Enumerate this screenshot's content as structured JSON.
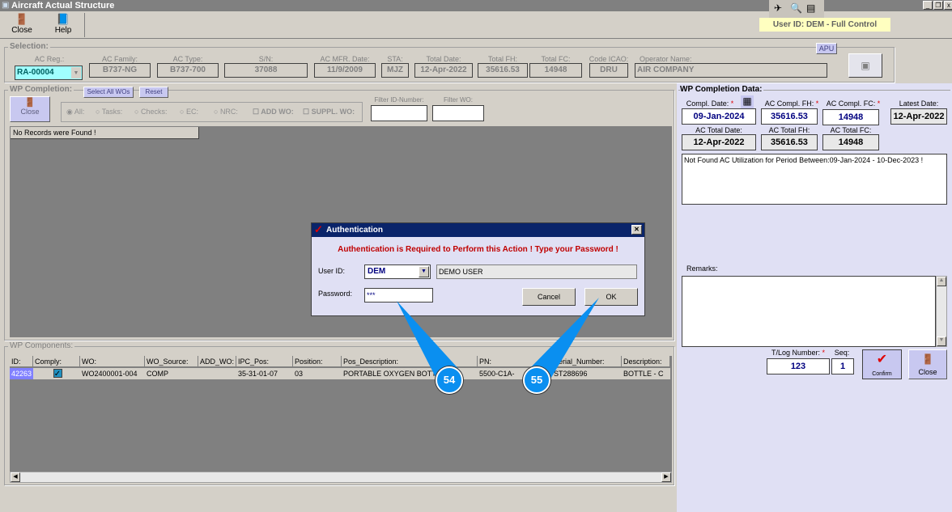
{
  "window": {
    "title": "Aircraft Actual Structure",
    "user_badge": "User ID: DEM - Full Control"
  },
  "toolbar": {
    "close": "Close",
    "help": "Help"
  },
  "selection": {
    "title": "Selection:",
    "apu": "APU",
    "fields": [
      {
        "label": "AC Reg.:",
        "value": "RA-00004"
      },
      {
        "label": "AC Family:",
        "value": "B737-NG"
      },
      {
        "label": "AC Type:",
        "value": "B737-700"
      },
      {
        "label": "S/N:",
        "value": "37088"
      },
      {
        "label": "AC MFR. Date:",
        "value": "11/9/2009"
      },
      {
        "label": "STA:",
        "value": "MJZ"
      },
      {
        "label": "Total Date:",
        "value": "12-Apr-2022"
      },
      {
        "label": "Total FH:",
        "value": "35616.53"
      },
      {
        "label": "Total FC:",
        "value": "14948"
      },
      {
        "label": "Code ICAO:",
        "value": "DRU"
      },
      {
        "label": "Operator Name:",
        "value": "AIR COMPANY"
      }
    ]
  },
  "wp_completion": {
    "title": "WP Completion:",
    "select_all": "Select All WOs",
    "reset": "Reset",
    "close": "Close",
    "radios": [
      "All:",
      "Tasks:",
      "Checks:",
      "EC:",
      "NRC:"
    ],
    "checks": [
      "ADD WO:",
      "SUPPL. WO:"
    ],
    "filter_id_label": "Filter ID-Number:",
    "filter_wo_label": "Filter WO:",
    "no_records": "No Records were Found !"
  },
  "wp_components": {
    "title": "WP Components:",
    "columns": [
      "ID:",
      "Comply:",
      "WO:",
      "WO_Source:",
      "ADD_WO:",
      "IPC_Pos:",
      "Position:",
      "Pos_Description:",
      "PN:",
      "Serial_Number:",
      "Description:"
    ],
    "rows": [
      [
        "42263",
        "",
        "WO2400001-004",
        "COMP",
        "",
        "35-31-01-07",
        "03",
        "PORTABLE OXYGEN BOTTLE",
        "5500-C1A-",
        "ST288696",
        "BOTTLE - C"
      ]
    ]
  },
  "wp_data": {
    "title": "WP Completion Data:",
    "compl_date_label": "Compl. Date:",
    "compl_date": "09-Jan-2024",
    "compl_fh_label": "AC Compl. FH:",
    "compl_fh": "35616.53",
    "compl_fc_label": "AC Compl. FC:",
    "compl_fc": "14948",
    "latest_label": "Latest Date:",
    "latest": "12-Apr-2022",
    "total_date_label": "AC Total Date:",
    "total_date": "12-Apr-2022",
    "total_fh_label": "AC Total FH:",
    "total_fh": "35616.53",
    "total_fc_label": "AC Total FC:",
    "total_fc": "14948",
    "message": "Not Found AC Utilization for Period Between:09-Jan-2024 - 10-Dec-2023 !",
    "remarks_label": "Remarks:",
    "tlog_label": "T/Log Number:",
    "tlog": "123",
    "seq_label": "Seq:",
    "seq": "1",
    "confirm": "Confirm",
    "close": "Close",
    "required": "*"
  },
  "dialog": {
    "title": "Authentication",
    "message": "Authentication is Required to Perform this Action ! Type your Password !",
    "user_label": "User ID:",
    "user": "DEM",
    "user_name": "DEMO USER",
    "password_label": "Password:",
    "password": "***",
    "cancel": "Cancel",
    "ok": "OK",
    "close": "✕"
  },
  "callouts": [
    "54",
    "55"
  ]
}
